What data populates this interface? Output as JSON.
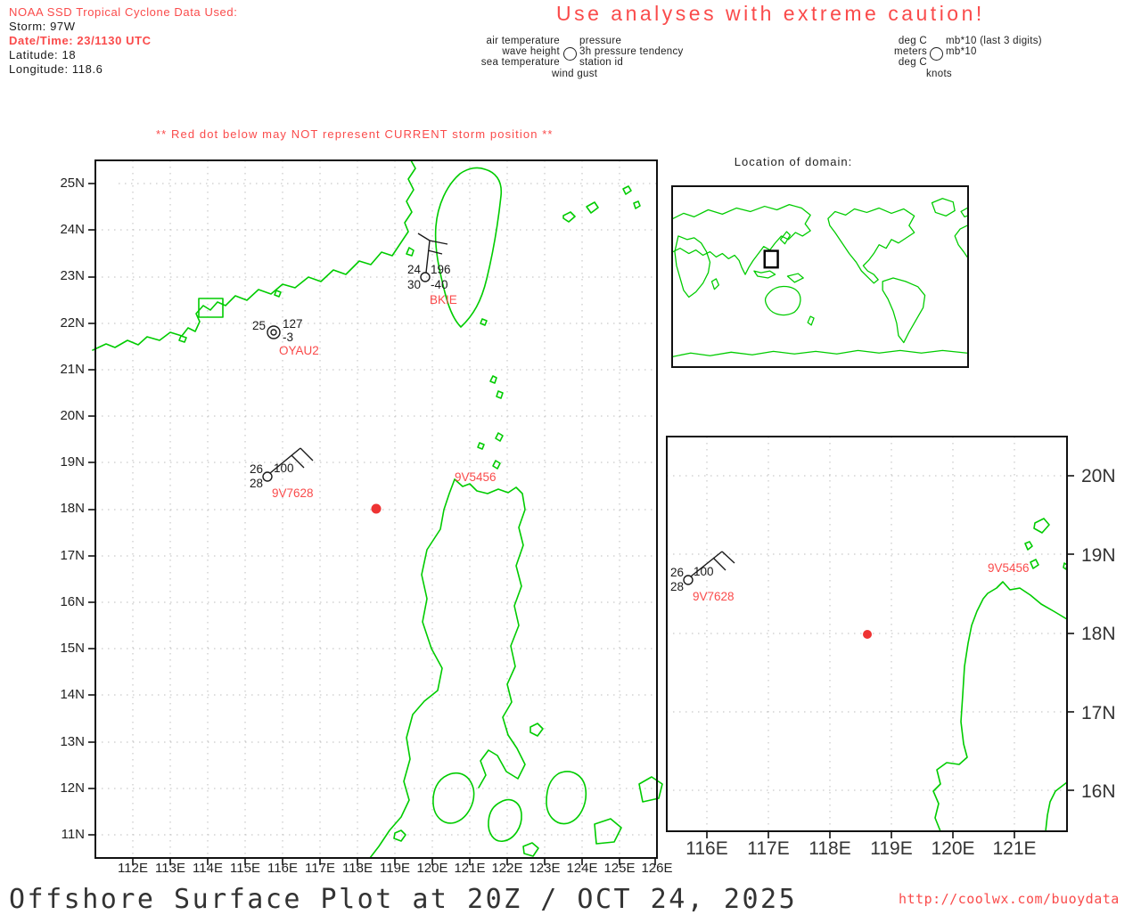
{
  "colors": {
    "accent_red": "#fa4b4b",
    "storm_dot_red": "#ee3333",
    "coast_green": "#00cc00",
    "grid_gray": "#bdbdbd"
  },
  "header": {
    "tc_info": {
      "title": "NOAA SSD Tropical Cyclone Data Used:",
      "storm": "Storm: 97W",
      "datetime": "Date/Time: 23/1130 UTC",
      "latitude": "Latitude: 18",
      "longitude": "Longitude: 118.6"
    },
    "caution": "Use analyses with extreme caution!",
    "legend_station": {
      "row1_left": "air temperature",
      "row2_left": "wave height",
      "row3_left": "sea temperature",
      "row4": "wind gust",
      "row1_right": "pressure",
      "row2_right": "3h pressure tendency",
      "row3_right": "station id"
    },
    "legend_units": {
      "row1_left": "deg C",
      "row2_left": "meters",
      "row3_left": "deg C",
      "row4": "knots",
      "row1_right": "mb*10 (last 3 digits)",
      "row2_right": "mb*10"
    }
  },
  "warning": "** Red dot below may NOT represent CURRENT storm position **",
  "main_map": {
    "lat_labels": [
      "25N",
      "24N",
      "23N",
      "22N",
      "21N",
      "20N",
      "19N",
      "18N",
      "17N",
      "16N",
      "15N",
      "14N",
      "13N",
      "12N",
      "11N"
    ],
    "lon_labels": [
      "112E",
      "113E",
      "114E",
      "115E",
      "116E",
      "117E",
      "118E",
      "119E",
      "120E",
      "121E",
      "122E",
      "123E",
      "124E",
      "125E",
      "126E"
    ],
    "stations": {
      "bkie": {
        "id": "BKIE",
        "air_temp": "24",
        "pressure": "196",
        "sea_temp": "30",
        "tendency": "-40"
      },
      "oyau2": {
        "id": "OYAU2",
        "air_temp": "25",
        "pressure": "127",
        "tendency": "-3"
      },
      "v7628": {
        "id": "9V7628",
        "air_temp": "26",
        "sea_temp": "28",
        "pressure": "100"
      },
      "v5456": {
        "id": "9V5456"
      }
    },
    "storm_dot": {
      "lat": 18,
      "lon": 118.6
    }
  },
  "world_inset": {
    "title": "Location of domain:"
  },
  "zoom_inset": {
    "lat_labels": [
      "20N",
      "19N",
      "18N",
      "17N",
      "16N"
    ],
    "lon_labels": [
      "116E",
      "117E",
      "118E",
      "119E",
      "120E",
      "121E"
    ],
    "stations": {
      "v7628": {
        "id": "9V7628",
        "air_temp": "26",
        "sea_temp": "28",
        "pressure": "100"
      },
      "v5456": {
        "id": "9V5456"
      }
    }
  },
  "footer": {
    "title": "Offshore Surface Plot at 20Z / OCT 24, 2025",
    "url": "http://coolwx.com/buoydata"
  }
}
